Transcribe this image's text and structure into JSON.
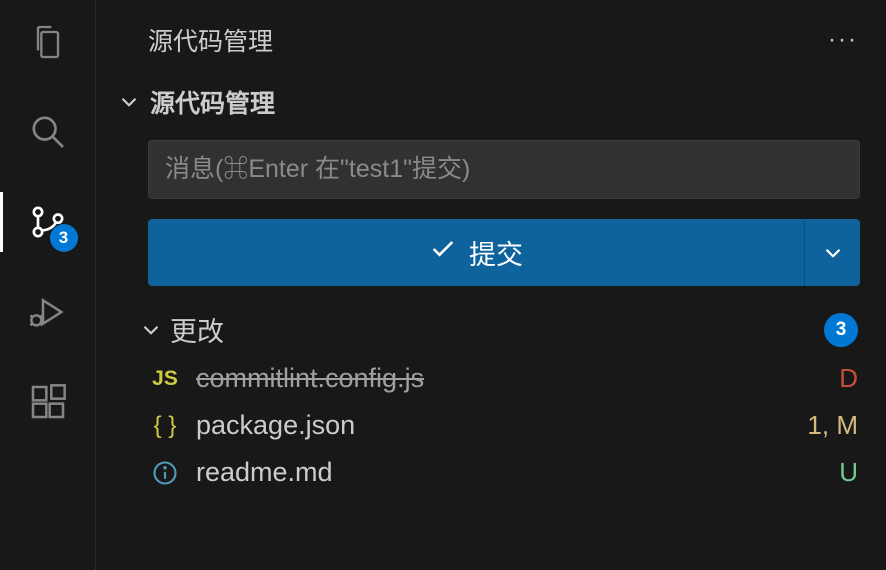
{
  "panel": {
    "title": "源代码管理",
    "more_label": "···"
  },
  "section": {
    "title": "源代码管理"
  },
  "commit": {
    "placeholder": "消息(⌘Enter 在\"test1\"提交)",
    "button_label": "提交"
  },
  "changes": {
    "title": "更改",
    "count": "3",
    "files": [
      {
        "icon_label": "JS",
        "name": "commitlint.config.js",
        "status": "D"
      },
      {
        "icon_label": "{ }",
        "name": "package.json",
        "status": "1, M"
      },
      {
        "icon_label": "info",
        "name": "readme.md",
        "status": "U"
      }
    ]
  },
  "activity": {
    "scm_badge": "3"
  }
}
